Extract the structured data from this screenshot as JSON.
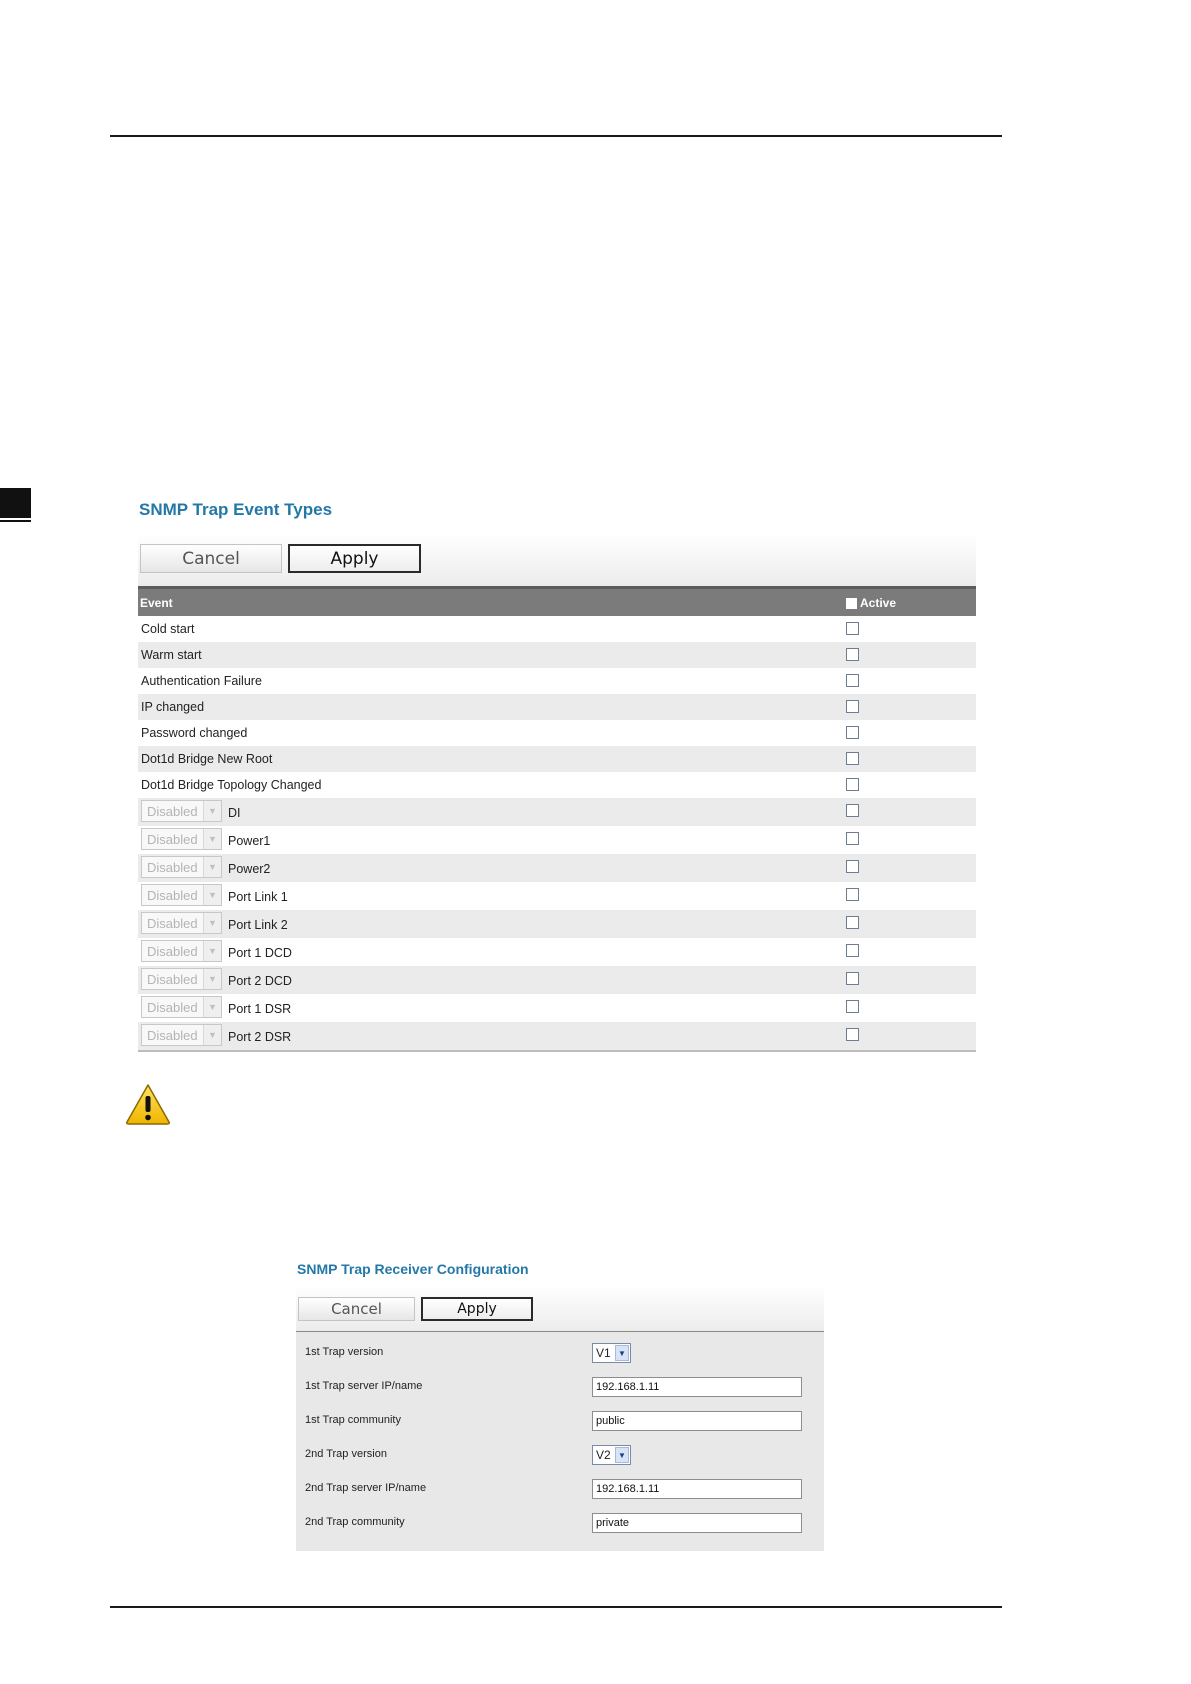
{
  "event_types": {
    "title": "SNMP Trap Event Types",
    "cancel_label": "Cancel",
    "apply_label": "Apply",
    "header_event": "Event",
    "header_active": "Active",
    "events": [
      {
        "label": "Cold start"
      },
      {
        "label": "Warm start"
      },
      {
        "label": "Authentication Failure"
      },
      {
        "label": "IP changed"
      },
      {
        "label": "Password changed"
      },
      {
        "label": "Dot1d Bridge New Root"
      },
      {
        "label": "Dot1d Bridge Topology Changed"
      }
    ],
    "dropdown_events": [
      {
        "select": "Disabled",
        "label": "DI"
      },
      {
        "select": "Disabled",
        "label": "Power1"
      },
      {
        "select": "Disabled",
        "label": "Power2"
      },
      {
        "select": "Disabled",
        "label": "Port Link 1"
      },
      {
        "select": "Disabled",
        "label": "Port Link 2"
      },
      {
        "select": "Disabled",
        "label": "Port 1 DCD"
      },
      {
        "select": "Disabled",
        "label": "Port 2 DCD"
      },
      {
        "select": "Disabled",
        "label": "Port 1 DSR"
      },
      {
        "select": "Disabled",
        "label": "Port 2 DSR"
      }
    ]
  },
  "receiver": {
    "title": "SNMP Trap Receiver Configuration",
    "cancel_label": "Cancel",
    "apply_label": "Apply",
    "rows": [
      {
        "label": "1st Trap version",
        "type": "select",
        "value": "V1"
      },
      {
        "label": "1st Trap server IP/name",
        "type": "input",
        "value": "192.168.1.11"
      },
      {
        "label": "1st Trap community",
        "type": "input",
        "value": "public"
      },
      {
        "label": "2nd Trap version",
        "type": "select",
        "value": "V2"
      },
      {
        "label": "2nd Trap server IP/name",
        "type": "input",
        "value": "192.168.1.11"
      },
      {
        "label": "2nd Trap community",
        "type": "input",
        "value": "private"
      }
    ]
  },
  "icons": {
    "warning": "warning-icon",
    "dropdown_arrow": "chevron-down-icon"
  },
  "colors": {
    "title_blue": "#2478a8",
    "table_header": "#7b7b7b",
    "row_alt": "#ebebeb",
    "warning_yellow": "#f6c400"
  }
}
